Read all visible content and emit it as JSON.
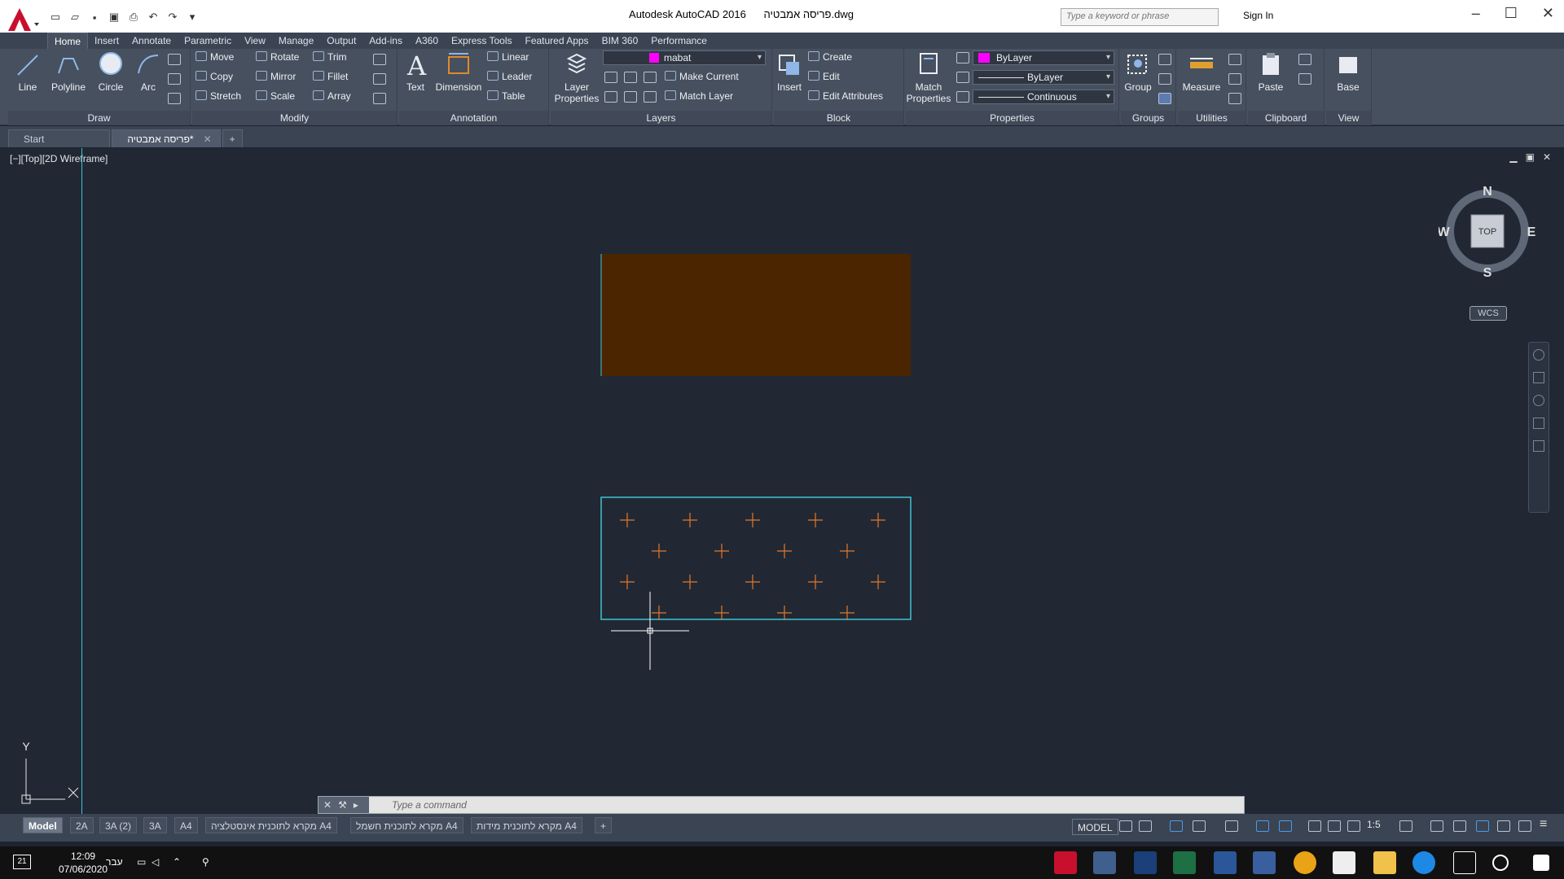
{
  "app": {
    "window_title": "Autodesk AutoCAD 2016      פריסה אמבטיה.dwg",
    "search_placeholder": "Type a keyword or phrase",
    "sign_in": "Sign In"
  },
  "ribbon_tabs": [
    "Home",
    "Insert",
    "Annotate",
    "Parametric",
    "View",
    "Manage",
    "Output",
    "Add-ins",
    "A360",
    "Express Tools",
    "Featured Apps",
    "BIM 360",
    "Performance"
  ],
  "ribbon": {
    "draw": {
      "line": "Line",
      "polyline": "Polyline",
      "circle": "Circle",
      "arc": "Arc",
      "title": "Draw"
    },
    "modify": {
      "move": "Move",
      "rotate": "Rotate",
      "trim": "Trim",
      "copy": "Copy",
      "mirror": "Mirror",
      "fillet": "Fillet",
      "stretch": "Stretch",
      "scale": "Scale",
      "array": "Array",
      "title": "Modify"
    },
    "annotation": {
      "text": "Text",
      "dimension": "Dimension",
      "linear": "Linear",
      "leader": "Leader",
      "table": "Table",
      "title": "Annotation"
    },
    "layers": {
      "layer_properties": "Layer Properties",
      "current_layer": "mabat",
      "make_current": "Make Current",
      "match_layer": "Match Layer",
      "title": "Layers"
    },
    "block": {
      "insert": "Insert",
      "create": "Create",
      "edit": "Edit",
      "edit_attributes": "Edit Attributes",
      "title": "Block"
    },
    "properties": {
      "match_properties": "Match Properties",
      "color": "ByLayer",
      "lineweight": "ByLayer",
      "linetype": "Continuous",
      "title": "Properties",
      "color_hex": "#ff00ff"
    },
    "groups": {
      "group": "Group",
      "title": "Groups"
    },
    "utilities": {
      "measure": "Measure",
      "title": "Utilities"
    },
    "clipboard": {
      "paste": "Paste",
      "title": "Clipboard"
    },
    "view": {
      "base": "Base",
      "title": "View"
    }
  },
  "doc_tabs": {
    "start": "Start",
    "active": "פריסה אמבטיה*"
  },
  "viewport": {
    "label": "[−][Top][2D Wireframe]",
    "viewcube": {
      "n": "N",
      "s": "S",
      "e": "E",
      "w": "W",
      "face": "TOP"
    },
    "wcs": "WCS",
    "ucs_y": "Y"
  },
  "command_line": {
    "placeholder": "Type a command"
  },
  "layout_tabs": [
    "Model",
    "2A",
    "3A (2)",
    "3A",
    "A4",
    "מקרא לתוכנית אינסטלציה  A4",
    "מקרא לתוכנית חשמל A4",
    "מקרא לתוכנית מידות A4"
  ],
  "status": {
    "model": "MODEL",
    "scale": "1:5"
  },
  "taskbar": {
    "time": "12:09",
    "date": "07/06/2020",
    "lang": "עבר",
    "notify_count": "21"
  },
  "colors": {
    "brand": "#c8102e",
    "fill_rect": "#4a2500",
    "cyan": "#3ec4d0",
    "cross": "#e2782a"
  }
}
